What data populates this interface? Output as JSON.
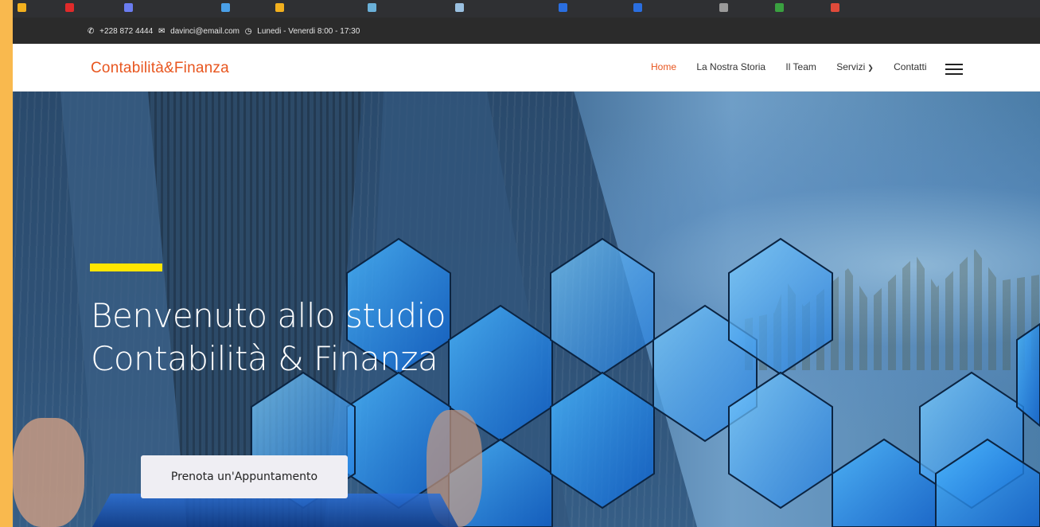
{
  "topbar": {
    "phone_icon": "phone-icon",
    "phone": "+228 872 4444",
    "email_icon": "envelope-icon",
    "email": "davinci@email.com",
    "clock_icon": "clock-icon",
    "hours": "Lunedi - Venerdi 8:00 - 17:30"
  },
  "navbar": {
    "logo": "Contabilità&Finanza",
    "items": [
      {
        "label": "Home",
        "active": true
      },
      {
        "label": "La Nostra Storia",
        "active": false
      },
      {
        "label": "Il Team",
        "active": false
      },
      {
        "label": "Servizi",
        "active": false,
        "dropdown": true
      },
      {
        "label": "Contatti",
        "active": false
      }
    ],
    "menu_icon": "hamburger-menu-icon"
  },
  "hero": {
    "title_line1": "Benvenuto allo studio",
    "title_line2": "Contabilità & Finanza",
    "cta_label": "Prenota un'Appuntamento"
  },
  "colors": {
    "brand_orange": "#e8561f",
    "accent_yellow": "#ffe600",
    "page_border": "#f9b94e",
    "topbar_bg": "#2b2b2b"
  }
}
